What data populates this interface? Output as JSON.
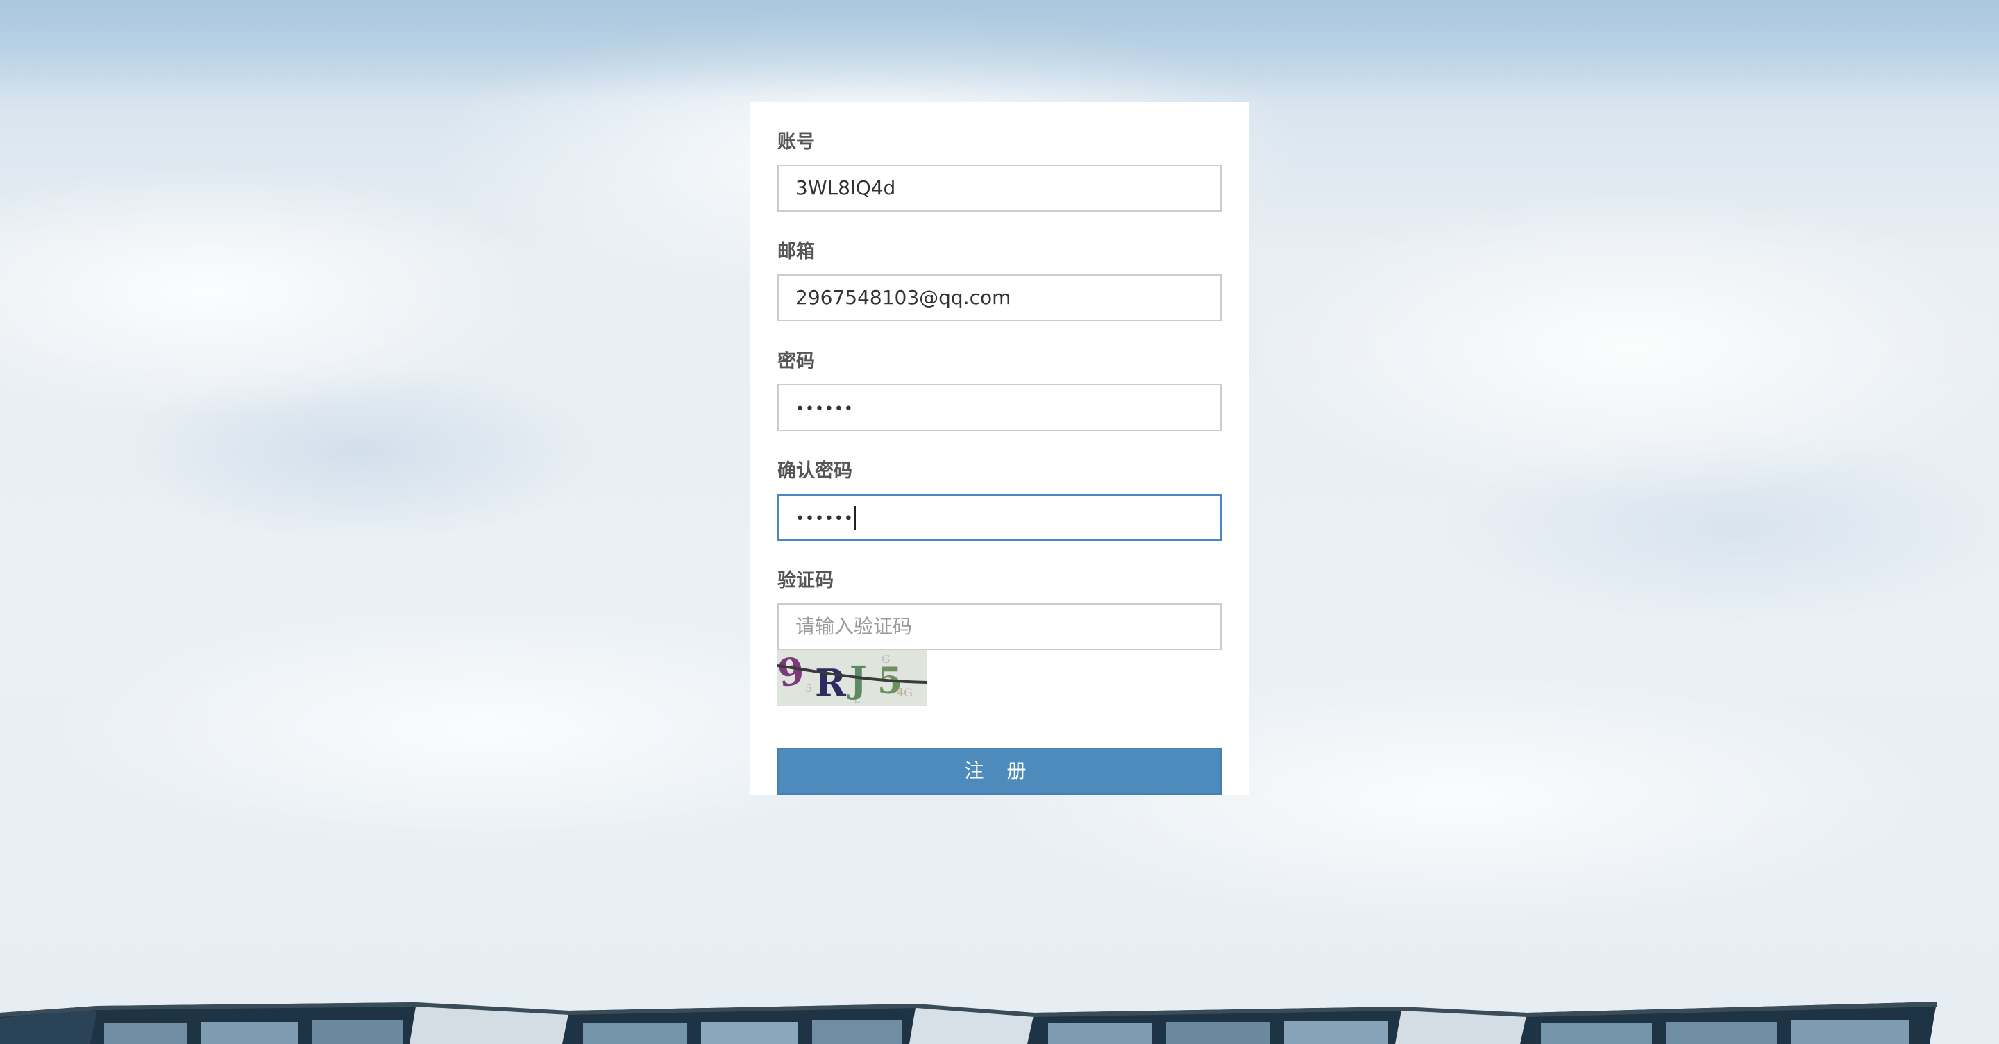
{
  "form": {
    "account": {
      "label": "账号",
      "value": "3WL8lQ4d"
    },
    "email": {
      "label": "邮箱",
      "value": "2967548103@qq.com"
    },
    "password": {
      "label": "密码",
      "masked_value": "••••••"
    },
    "confirm_password": {
      "label": "确认密码",
      "masked_value": "••••••",
      "focused": true
    },
    "captcha": {
      "label": "验证码",
      "placeholder": "请输入验证码",
      "image_text": "9RJ5"
    },
    "submit_label": "注 册"
  },
  "colors": {
    "button": "#4d8bbd",
    "focus_border": "#4a86c1",
    "label": "#555555",
    "card": "#ffffff"
  }
}
